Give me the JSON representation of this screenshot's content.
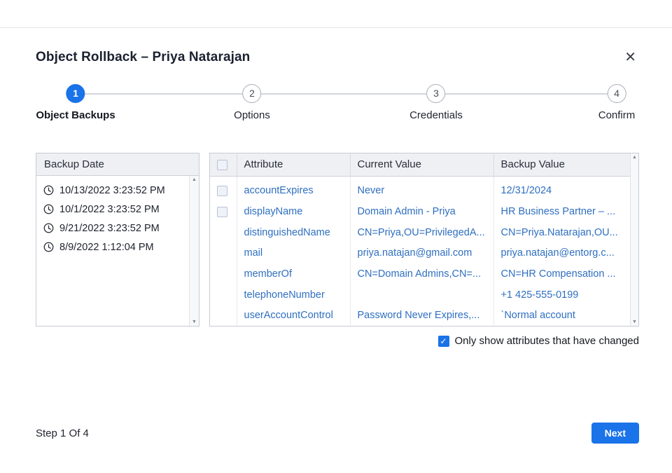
{
  "dialog": {
    "title": "Object Rollback – Priya Natarajan"
  },
  "icons": {
    "close": "✕",
    "check": "✓",
    "scroll_up": "▲",
    "scroll_down": "▼"
  },
  "stepper": {
    "active_step": "1",
    "steps": [
      {
        "number": "1",
        "label": "Object Backups"
      },
      {
        "number": "2",
        "label": "Options"
      },
      {
        "number": "3",
        "label": "Credentials"
      },
      {
        "number": "4",
        "label": "Confirm"
      }
    ]
  },
  "backup_panel": {
    "header": "Backup Date",
    "items": [
      "10/13/2022 3:23:52 PM",
      "10/1/2022 3:23:52 PM",
      "9/21/2022 3:23:52 PM",
      "8/9/2022 1:12:04 PM"
    ]
  },
  "attributes_table": {
    "columns": {
      "attribute": "Attribute",
      "current": "Current Value",
      "backup": "Backup Value"
    },
    "rows": [
      {
        "attribute": "accountExpires",
        "current": "Never",
        "backup": "12/31/2024"
      },
      {
        "attribute": "displayName",
        "current": "Domain Admin  - Priya",
        "backup": "HR Business Partner – ..."
      },
      {
        "attribute": "distinguishedName",
        "current": "CN=Priya,OU=PrivilegedA...",
        "backup": "CN=Priya.Natarajan,OU..."
      },
      {
        "attribute": "mail",
        "current": "priya.natajan@gmail.com",
        "backup": "priya.natajan@entorg.c..."
      },
      {
        "attribute": "memberOf",
        "current": "CN=Domain Admins,CN=...",
        "backup": "CN=HR Compensation ..."
      },
      {
        "attribute": "telephoneNumber",
        "current": "",
        "backup": "+1 425-555-0199"
      },
      {
        "attribute": "userAccountControl",
        "current": "Password Never Expires,...",
        "backup": "`Normal account"
      }
    ]
  },
  "filter_checkbox": {
    "label": "Only show attributes that have changed",
    "checked": true
  },
  "footer": {
    "step_text": "Step 1 Of 4",
    "next_label": "Next"
  },
  "colors": {
    "accent": "#1a73e8",
    "link_text": "#2e6fc0"
  }
}
